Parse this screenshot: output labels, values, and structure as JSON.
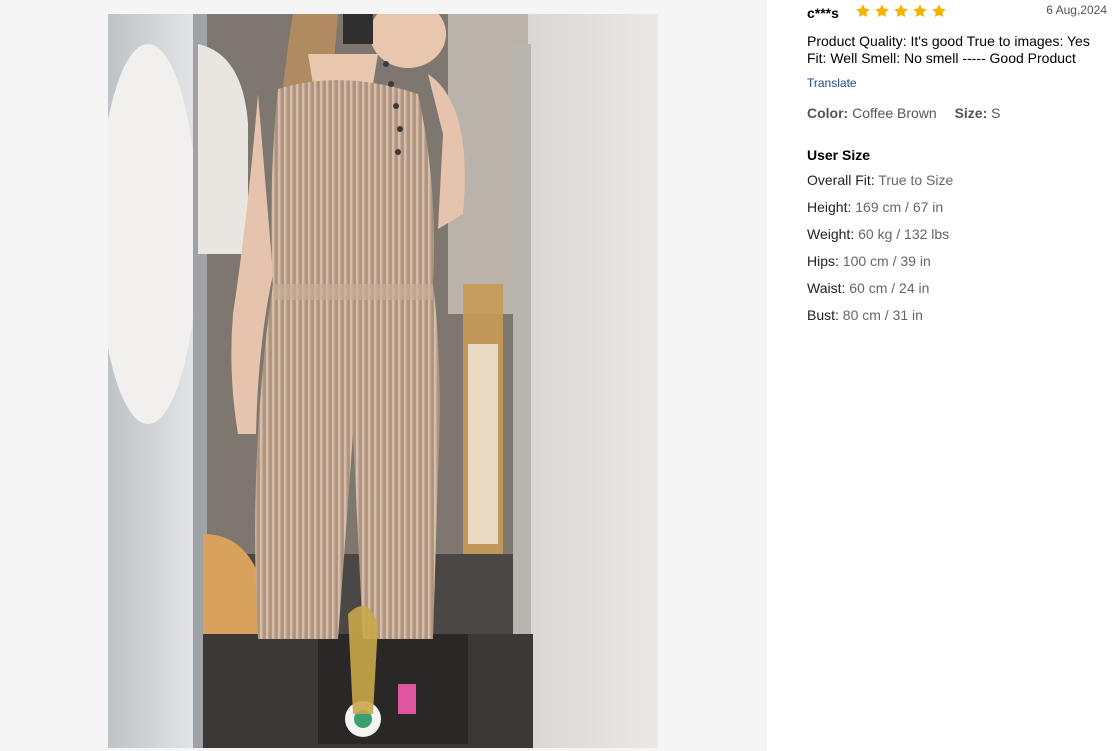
{
  "review": {
    "user": "c***s",
    "rating": 5,
    "star_color": "#f6b200",
    "date": "6 Aug,2024",
    "content": "Product Quality: It's good True to images: Yes Fit: Well Smell: No smell ----- Good Product",
    "translate_label": "Translate",
    "color_label": "Color:",
    "color_value": "Coffee Brown",
    "size_label": "Size:",
    "size_value": "S"
  },
  "user_size": {
    "title": "User Size",
    "rows": [
      {
        "label": "Overall Fit:",
        "value": "True to Size"
      },
      {
        "label": "Height:",
        "value": "169 cm / 67 in"
      },
      {
        "label": "Weight:",
        "value": "60 kg / 132 lbs"
      },
      {
        "label": "Hips:",
        "value": "100 cm / 39 in"
      },
      {
        "label": "Waist:",
        "value": "60 cm / 24 in"
      },
      {
        "label": "Bust:",
        "value": "80 cm / 31 in"
      }
    ]
  },
  "photo": {
    "alt": "Customer photo wearing pleated coffee brown jumpsuit"
  }
}
